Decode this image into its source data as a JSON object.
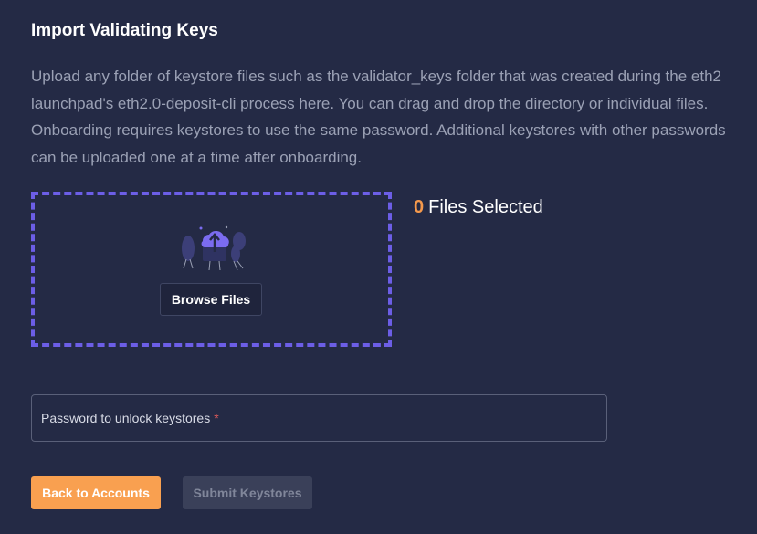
{
  "header": {
    "title": "Import Validating Keys"
  },
  "description": "Upload any folder of keystore files such as the validator_keys folder that was created during the eth2 launchpad's eth2.0-deposit-cli process here. You can drag and drop the directory or individual files. Onboarding requires keystores to use the same password. Additional keystores with other passwords can be uploaded one at a time after onboarding.",
  "dropzone": {
    "illustration_icon": "cloud-upload-icon",
    "browse_label": "Browse Files"
  },
  "files": {
    "count": "0",
    "label": "Files Selected"
  },
  "password": {
    "label": "Password to unlock keystores",
    "required_mark": "*",
    "value": ""
  },
  "actions": {
    "back_label": "Back to Accounts",
    "submit_label": "Submit Keystores",
    "submit_disabled": true
  },
  "colors": {
    "background": "#242a45",
    "accent_orange": "#f9a050",
    "dropzone_border": "#6c5ee6",
    "required": "#e05a5a"
  }
}
